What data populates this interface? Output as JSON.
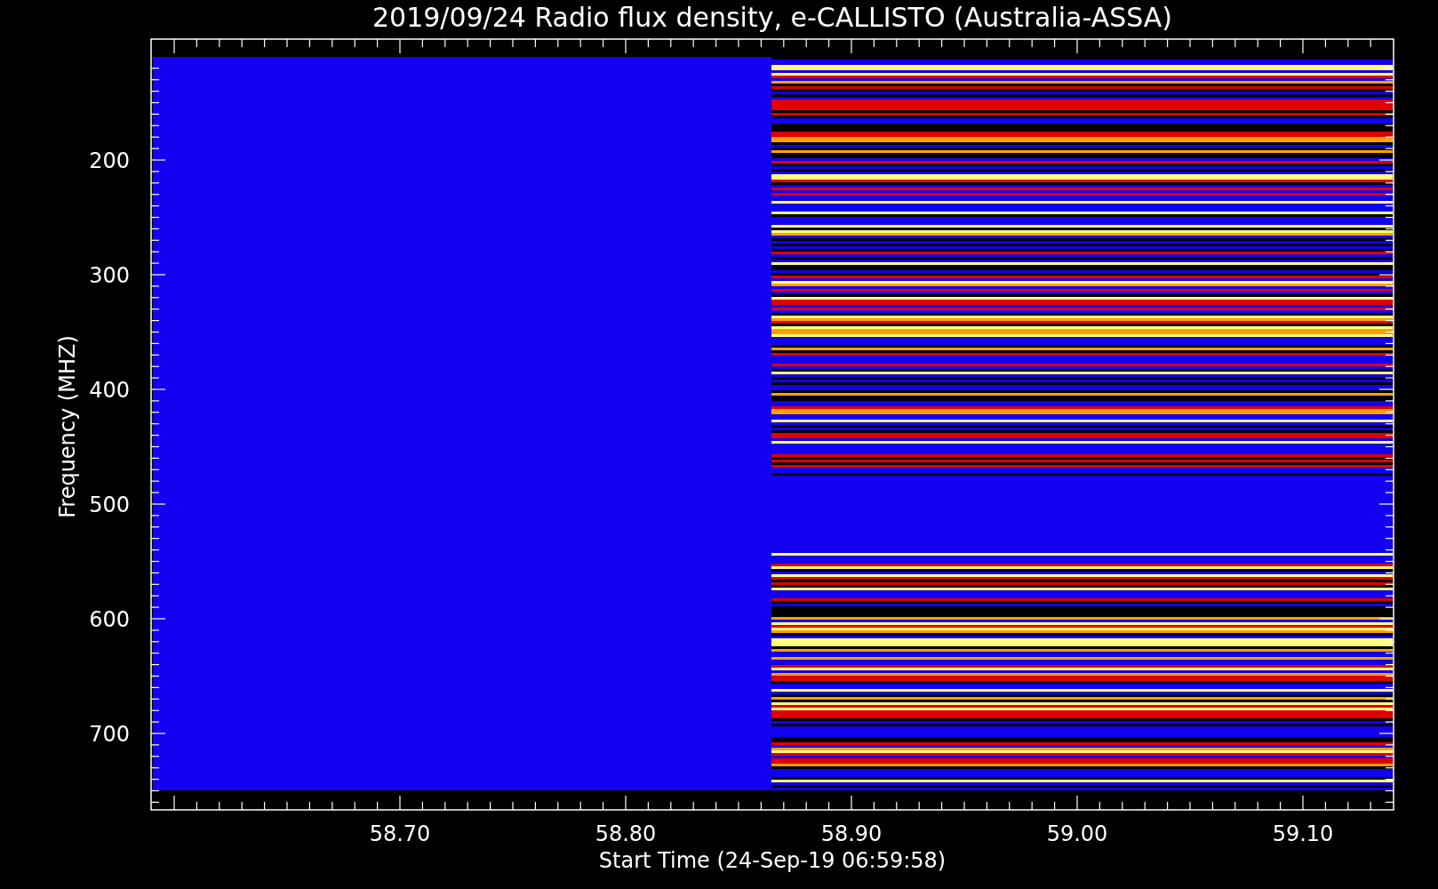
{
  "title": "2019/09/24  Radio flux density, e-CALLISTO (Australia-ASSA)",
  "ylabel": "Frequency (MHZ)",
  "xlabel": "Start Time (24-Sep-19 06:59:58)",
  "yticks": [
    "200",
    "300",
    "400",
    "500",
    "600",
    "700"
  ],
  "xticks": [
    "58.70",
    "58.80",
    "58.90",
    "59.00",
    "59.10"
  ]
}
